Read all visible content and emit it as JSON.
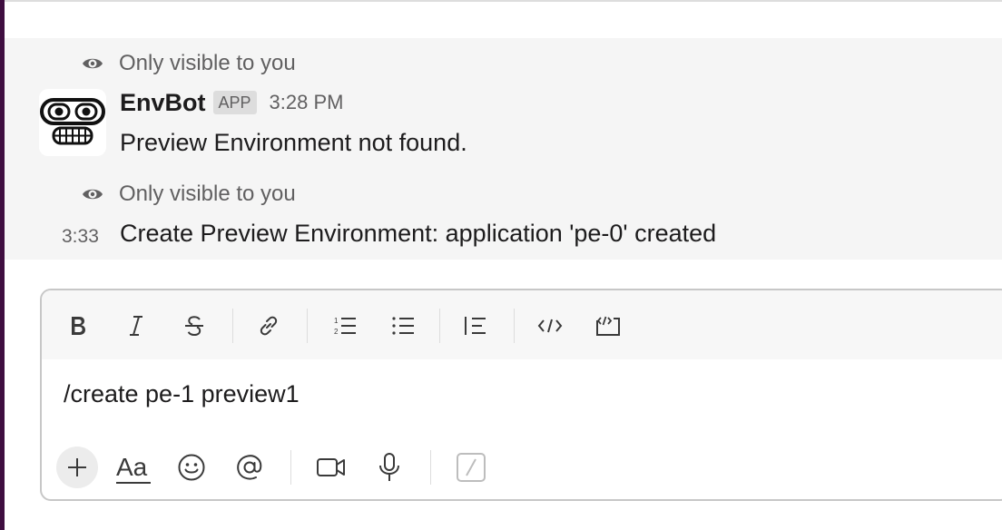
{
  "messages": [
    {
      "visibility": "Only visible to you",
      "sender": "EnvBot",
      "badge": "APP",
      "time": "3:28 PM",
      "text": "Preview Environment not found."
    },
    {
      "visibility": "Only visible to you",
      "time": "3:33",
      "text": "Create Preview Environment: application 'pe-0' created"
    }
  ],
  "composer": {
    "value": "/create pe-1 preview1",
    "format_icons": [
      "bold-icon",
      "italic-icon",
      "strikethrough-icon",
      "link-icon",
      "ordered-list-icon",
      "bulleted-list-icon",
      "blockquote-icon",
      "code-icon",
      "code-block-icon"
    ],
    "bottom_icons": [
      "plus-icon",
      "text-format-icon",
      "emoji-icon",
      "mention-icon",
      "video-icon",
      "microphone-icon",
      "slash-command-icon"
    ]
  },
  "colors": {
    "workspace_rail": "#3f0e40",
    "message_highlight": "#f5f5f5",
    "muted_text": "#616061"
  }
}
